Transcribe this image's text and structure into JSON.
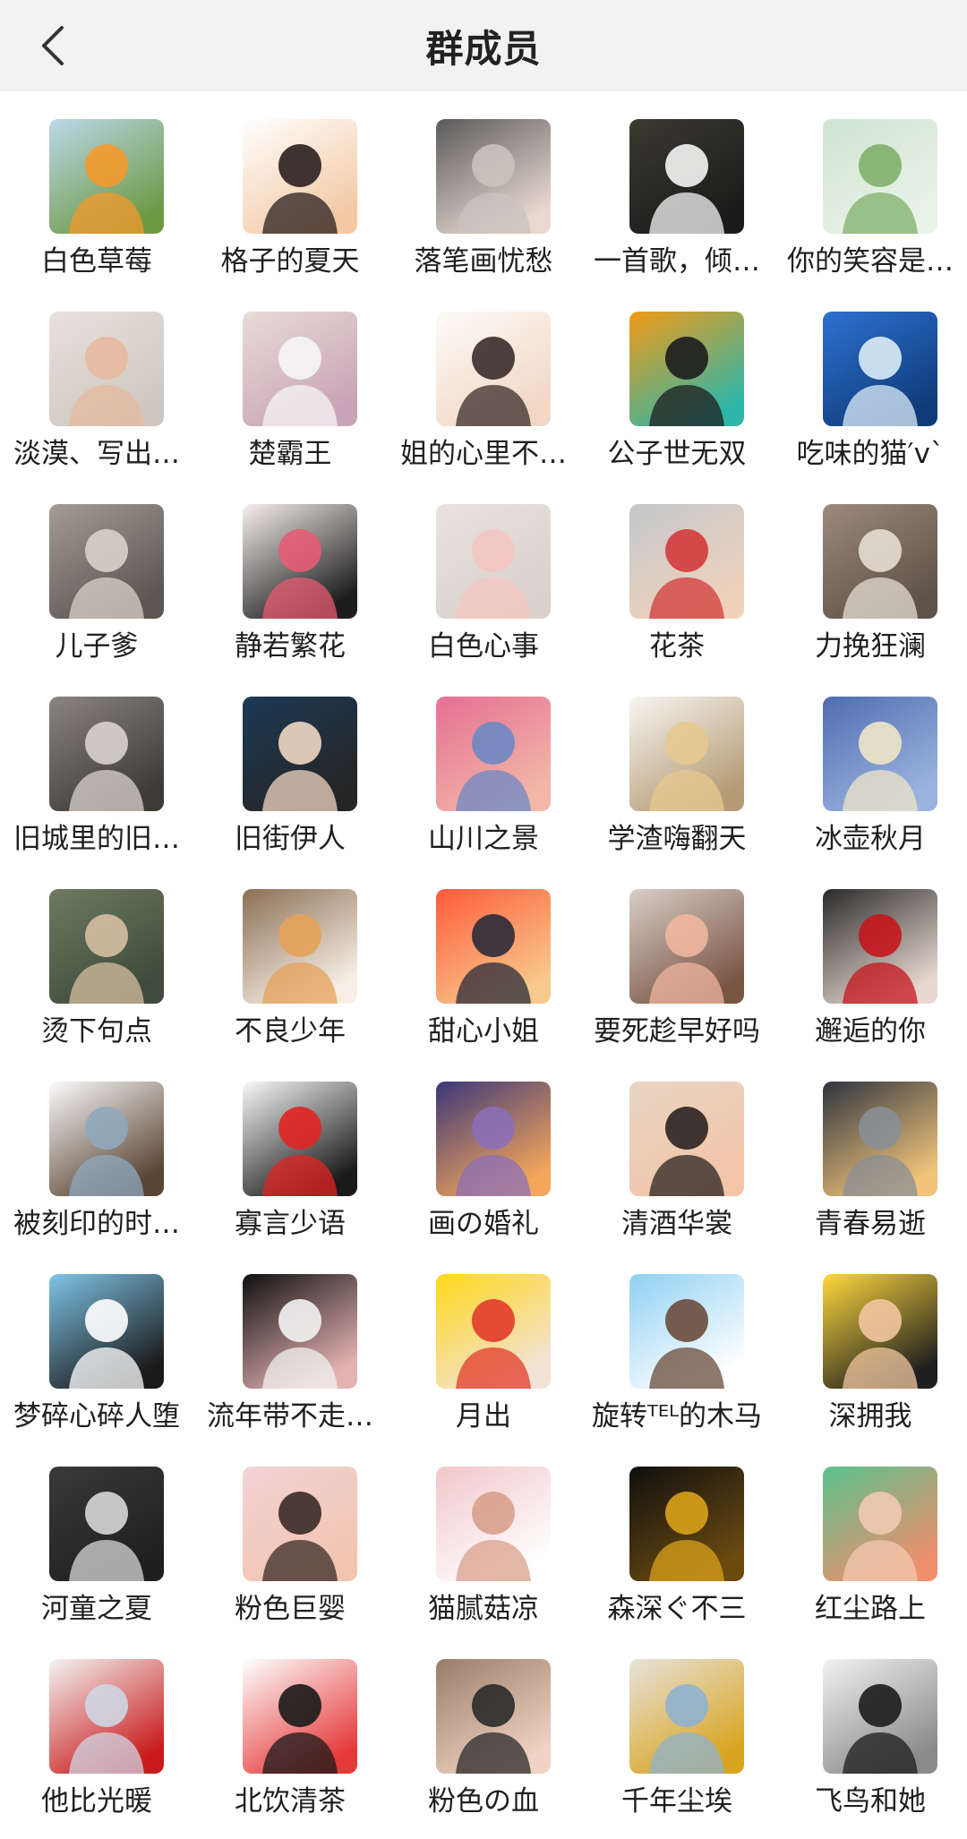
{
  "header": {
    "title": "群成员",
    "back_icon": "chevron-left-icon"
  },
  "members": [
    {
      "name": "白色草莓",
      "avatar": "orange-flowers",
      "colors": [
        "#bcd8ea",
        "#f39a2c",
        "#6e9a46"
      ]
    },
    {
      "name": "格子的夏天",
      "avatar": "cartoon-boy",
      "colors": [
        "#ffffff",
        "#2a1f1f",
        "#f3c9a4"
      ]
    },
    {
      "name": "落笔画忧愁",
      "avatar": "anime-girl-gray",
      "colors": [
        "#5a5a5a",
        "#c9c3bd",
        "#e8d8d0"
      ]
    },
    {
      "name": "一首歌，倾…",
      "avatar": "girl-dark-room",
      "colors": [
        "#3b3a30",
        "#f5f5f5",
        "#1b1b1b"
      ]
    },
    {
      "name": "你的笑容是…",
      "avatar": "green-keyboard",
      "colors": [
        "#cfe3cf",
        "#7fb06a",
        "#eaf3ea"
      ]
    },
    {
      "name": "淡漠、写出…",
      "avatar": "baby-photo",
      "colors": [
        "#e8e2dc",
        "#e7b9a0",
        "#cfc7c0"
      ]
    },
    {
      "name": "楚霸王",
      "avatar": "white-dog",
      "colors": [
        "#e9dcd6",
        "#f6f6f6",
        "#c9a3b6"
      ]
    },
    {
      "name": "姐的心里不…",
      "avatar": "anime-boy-glasses",
      "colors": [
        "#fdfbf8",
        "#3a2c2a",
        "#f2d7c5"
      ]
    },
    {
      "name": "公子世无双",
      "avatar": "black-cat",
      "colors": [
        "#f39a16",
        "#1c1c1c",
        "#2fb6a8"
      ]
    },
    {
      "name": "吃味的猫′v`",
      "avatar": "blue-sky",
      "colors": [
        "#2d72d2",
        "#dcecf8",
        "#103b7a"
      ]
    },
    {
      "name": "儿子爹",
      "avatar": "tabby-cat",
      "colors": [
        "#a59c94",
        "#d9d2ca",
        "#5c5550"
      ]
    },
    {
      "name": "静若繁花",
      "avatar": "girl-glasses-cap",
      "colors": [
        "#f6f0ee",
        "#e55c73",
        "#1d1d1d"
      ]
    },
    {
      "name": "白色心事",
      "avatar": "baby-cat-filter",
      "colors": [
        "#e9e2dd",
        "#f4c5c2",
        "#d9d1cc"
      ]
    },
    {
      "name": "花茶",
      "avatar": "toddler-red",
      "colors": [
        "#c3c8cc",
        "#d33a3a",
        "#f0d2bb"
      ]
    },
    {
      "name": "力挽狂澜",
      "avatar": "fluffy-kitten",
      "colors": [
        "#9c8a7c",
        "#e7ddd3",
        "#5f5248"
      ]
    },
    {
      "name": "旧城里的旧…",
      "avatar": "woman-bw",
      "colors": [
        "#8a8580",
        "#d8d3cd",
        "#3e3a36"
      ]
    },
    {
      "name": "旧街伊人",
      "avatar": "anime-boy-dark",
      "colors": [
        "#1c3a56",
        "#f1d7c2",
        "#252525"
      ]
    },
    {
      "name": "山川之景",
      "avatar": "pink-sunset",
      "colors": [
        "#e56f93",
        "#6b88c4",
        "#f2b7a7"
      ]
    },
    {
      "name": "学渣嗨翻天",
      "avatar": "anime-blond-boy",
      "colors": [
        "#f8f6f2",
        "#e7c98f",
        "#b59b75"
      ]
    },
    {
      "name": "冰壶秋月",
      "avatar": "anime-boy-sky",
      "colors": [
        "#4f6db0",
        "#f0e5c8",
        "#9bb4df"
      ]
    },
    {
      "name": "烫下句点",
      "avatar": "baby-laugh",
      "colors": [
        "#6d7b62",
        "#d6bfa2",
        "#3e4a3a"
      ]
    },
    {
      "name": "不良少年",
      "avatar": "shiba-dog",
      "colors": [
        "#8c6f54",
        "#e4a25a",
        "#f7efe6"
      ]
    },
    {
      "name": "甜心小姐",
      "avatar": "palm-sunset",
      "colors": [
        "#ff5a3c",
        "#2a2a38",
        "#f7c98a"
      ]
    },
    {
      "name": "要死趁早好吗",
      "avatar": "little-girl",
      "colors": [
        "#d9cfc8",
        "#f0b69f",
        "#7a5544"
      ]
    },
    {
      "name": "邂逅的你",
      "avatar": "red-umbrella-girl",
      "colors": [
        "#2a2a2a",
        "#c4161c",
        "#e7d8cf"
      ]
    },
    {
      "name": "被刻印的时…",
      "avatar": "sketch-boy",
      "colors": [
        "#fbfbfb",
        "#8fa9be",
        "#5a4433"
      ]
    },
    {
      "name": "寡言少语",
      "avatar": "cola-boy",
      "colors": [
        "#f8f8f8",
        "#e12424",
        "#1a1a1a"
      ]
    },
    {
      "name": "画の婚礼",
      "avatar": "purple-sea",
      "colors": [
        "#3b3778",
        "#8b6fb8",
        "#f4a65a"
      ]
    },
    {
      "name": "清酒华裳",
      "avatar": "couple-photo",
      "colors": [
        "#e9d6c4",
        "#2a2220",
        "#f2c4a8"
      ]
    },
    {
      "name": "青春易逝",
      "avatar": "night-street",
      "colors": [
        "#2f3440",
        "#8a8f96",
        "#f1c47a"
      ]
    },
    {
      "name": "梦碎心碎人堕",
      "avatar": "sketch-girl",
      "colors": [
        "#7fc5e8",
        "#ffffff",
        "#1a1a1a"
      ]
    },
    {
      "name": "流年带不走…",
      "avatar": "white-hair-girl",
      "colors": [
        "#0f0f0f",
        "#f2f2f2",
        "#e5b2b2"
      ]
    },
    {
      "name": "月出",
      "avatar": "yellow-helmet-meme",
      "colors": [
        "#ffd81a",
        "#e23b2a",
        "#f2e2d8"
      ]
    },
    {
      "name": "旋转ᵀᴱᴸ的木马",
      "avatar": "default-person",
      "colors": [
        "#8fd0f3",
        "#6b4b3a",
        "#ffffff"
      ]
    },
    {
      "name": "深拥我",
      "avatar": "naruto-chibi",
      "colors": [
        "#ffd93d",
        "#f2c6a0",
        "#1f1f1f"
      ]
    },
    {
      "name": "河童之夏",
      "avatar": "boy-bw",
      "colors": [
        "#3a3a3a",
        "#d7d7d7",
        "#1f1f1f"
      ]
    },
    {
      "name": "粉色巨婴",
      "avatar": "girl-portrait",
      "colors": [
        "#f3d3d6",
        "#3a2a25",
        "#f1c5b0"
      ]
    },
    {
      "name": "猫腻菇凉",
      "avatar": "baby-pink",
      "colors": [
        "#f1c6c9",
        "#d9a08c",
        "#ffffff"
      ]
    },
    {
      "name": "森深ぐ不三",
      "avatar": "golden-wolf",
      "colors": [
        "#0f0f0f",
        "#d9a21b",
        "#6b4a10"
      ]
    },
    {
      "name": "红尘路上",
      "avatar": "chibi-green-hat",
      "colors": [
        "#59c18c",
        "#f2c9b2",
        "#ef8f6d"
      ]
    },
    {
      "name": "他比光暖",
      "avatar": "anime-white-hair",
      "colors": [
        "#f4f4f4",
        "#cfd6e4",
        "#c91b1b"
      ]
    },
    {
      "name": "北饮清茶",
      "avatar": "sketch-glasses",
      "colors": [
        "#ffffff",
        "#1a1a1a",
        "#e53a3a"
      ]
    },
    {
      "name": "粉色の血",
      "avatar": "couple-selfie",
      "colors": [
        "#9a7c6a",
        "#2a2a2a",
        "#f0d3c2"
      ]
    },
    {
      "name": "千年尘埃",
      "avatar": "sea-back",
      "colors": [
        "#e7e2dc",
        "#8fb3d0",
        "#d9a51f"
      ]
    },
    {
      "name": "飞鸟和她",
      "avatar": "anime-girl-bw",
      "colors": [
        "#f2f2f2",
        "#1c1c1c",
        "#8a8a8a"
      ]
    }
  ]
}
